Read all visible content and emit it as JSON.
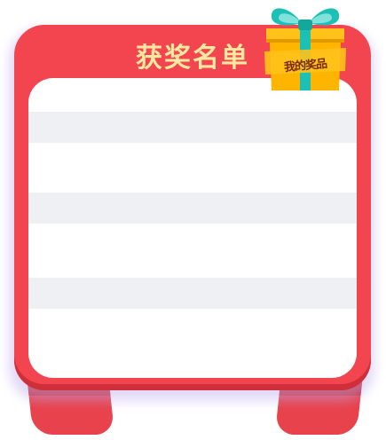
{
  "panel": {
    "title": "获奖名单",
    "rows": [
      {
        "text": ""
      },
      {
        "text": ""
      },
      {
        "text": ""
      },
      {
        "text": ""
      },
      {
        "text": ""
      },
      {
        "text": ""
      },
      {
        "text": ""
      },
      {
        "text": ""
      },
      {
        "text": ""
      }
    ]
  },
  "gift_button": {
    "label": "我的奖品",
    "icon": "gift-box-icon"
  },
  "colors": {
    "panel_red": "#f3454f",
    "title_yellow": "#ffe9a0",
    "row_stripe": "#eff0f3",
    "gift_orange": "#ffb400",
    "ribbon_teal": "#1cc0b4"
  }
}
